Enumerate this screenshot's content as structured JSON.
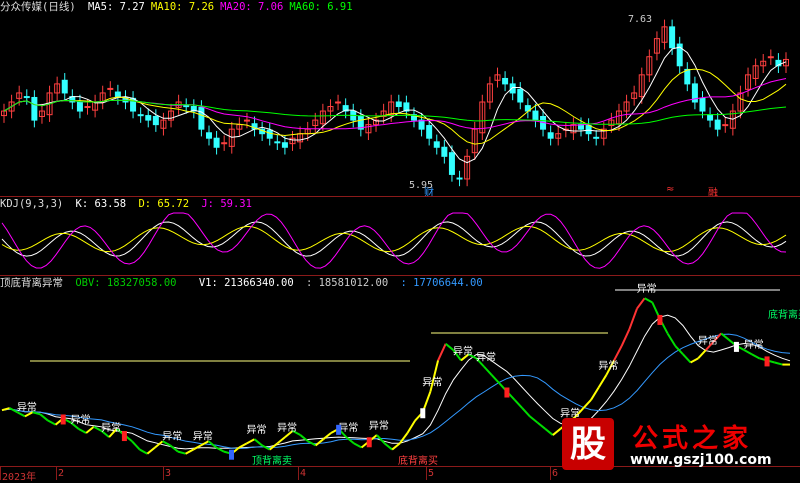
{
  "price_panel": {
    "title": "分众传媒(日线)",
    "ma": [
      {
        "label": "MA5: ",
        "value": "7.27",
        "color": "#ffffff"
      },
      {
        "label": "MA10: ",
        "value": "7.26",
        "color": "#ffff00"
      },
      {
        "label": "MA20: ",
        "value": "7.06",
        "color": "#ff00ff"
      },
      {
        "label": "MA60: ",
        "value": "6.91",
        "color": "#00ff00"
      }
    ],
    "high_label": "7.63",
    "low_label": "5.95",
    "badge_left": "财",
    "badge_right_a": "≈",
    "badge_right_b": "融"
  },
  "kdj_panel": {
    "title": "KDJ(9,3,3)",
    "k": "K: 63.58",
    "d": "D: 65.72",
    "j": "J: 59.31",
    "k_color": "#ffffff",
    "d_color": "#ffff00",
    "j_color": "#ff00ff"
  },
  "obv_panel": {
    "title": "顶底背离异常",
    "obv": "OBV: 18327058.00",
    "v1": "V1: 21366340.00",
    "v2": ": 18581012.00",
    "v3": ": 17706644.00",
    "obv_color": "#00cc00",
    "v1_color": "#ffffff",
    "v2_color": "#cccccc",
    "v3_color": "#3399ff",
    "label_abnormal": "异常",
    "label_top": "顶背离卖",
    "label_bottom": "底背离买",
    "label_top_right": "底背离买"
  },
  "x_axis": {
    "labels": [
      {
        "text": "2023年"
      },
      {
        "text": "2"
      },
      {
        "text": "3"
      },
      {
        "text": "4"
      },
      {
        "text": "5"
      },
      {
        "text": "6"
      }
    ]
  },
  "logo": {
    "glyph": "股",
    "name": "公式之家",
    "url": "www.gszj100.com"
  },
  "chart_data": [
    {
      "type": "candlestick",
      "title": "分众传媒(日线)",
      "series": [
        {
          "name": "MA5",
          "color": "#ffffff"
        },
        {
          "name": "MA10",
          "color": "#ffff00"
        },
        {
          "name": "MA20",
          "color": "#ff00ff"
        },
        {
          "name": "MA60",
          "color": "#00ff00"
        }
      ],
      "close": [
        6.7,
        6.8,
        6.9,
        6.85,
        6.6,
        6.7,
        6.9,
        7.0,
        6.9,
        6.8,
        6.7,
        6.75,
        6.8,
        6.9,
        6.95,
        6.85,
        6.8,
        6.7,
        6.65,
        6.6,
        6.55,
        6.6,
        6.7,
        6.8,
        6.75,
        6.7,
        6.5,
        6.4,
        6.3,
        6.35,
        6.5,
        6.55,
        6.6,
        6.5,
        6.45,
        6.4,
        6.35,
        6.3,
        6.4,
        6.45,
        6.5,
        6.6,
        6.7,
        6.75,
        6.8,
        6.7,
        6.6,
        6.5,
        6.55,
        6.6,
        6.7,
        6.8,
        6.75,
        6.7,
        6.6,
        6.5,
        6.4,
        6.3,
        6.2,
        6.0,
        5.95,
        6.2,
        6.5,
        6.8,
        7.0,
        7.1,
        7.0,
        6.9,
        6.8,
        6.7,
        6.6,
        6.5,
        6.4,
        6.45,
        6.5,
        6.55,
        6.5,
        6.45,
        6.4,
        6.5,
        6.6,
        6.7,
        6.8,
        6.9,
        7.1,
        7.3,
        7.5,
        7.63,
        7.4,
        7.2,
        7.0,
        6.8,
        6.7,
        6.6,
        6.5,
        6.55,
        6.7,
        6.9,
        7.1,
        7.2,
        7.25,
        7.3,
        7.2,
        7.27
      ],
      "high": 7.63,
      "low": 5.95
    },
    {
      "type": "line",
      "title": "KDJ(9,3,3)",
      "series": [
        {
          "name": "K",
          "last": 63.58
        },
        {
          "name": "D",
          "last": 65.72
        },
        {
          "name": "J",
          "last": 59.31
        }
      ]
    },
    {
      "type": "line",
      "title": "顶底背离异常",
      "series": [
        {
          "name": "OBV",
          "last": 18327058.0
        },
        {
          "name": "V1",
          "last": 21366340.0
        },
        {
          "name": "",
          "last": 18581012.0
        },
        {
          "name": "",
          "last": 17706644.0
        }
      ],
      "obv": [
        1.61,
        1.62,
        1.6,
        1.58,
        1.6,
        1.59,
        1.56,
        1.54,
        1.57,
        1.55,
        1.52,
        1.5,
        1.53,
        1.51,
        1.48,
        1.52,
        1.49,
        1.46,
        1.42,
        1.4,
        1.43,
        1.46,
        1.44,
        1.41,
        1.4,
        1.42,
        1.44,
        1.46,
        1.43,
        1.41,
        1.4,
        1.43,
        1.45,
        1.47,
        1.44,
        1.42,
        1.45,
        1.48,
        1.51,
        1.49,
        1.46,
        1.44,
        1.47,
        1.5,
        1.52,
        1.48,
        1.45,
        1.43,
        1.46,
        1.49,
        1.45,
        1.42,
        1.45,
        1.5,
        1.56,
        1.6,
        1.7,
        1.85,
        1.93,
        1.9,
        1.85,
        1.88,
        1.86,
        1.82,
        1.78,
        1.74,
        1.7,
        1.66,
        1.62,
        1.58,
        1.55,
        1.52,
        1.49,
        1.52,
        1.55,
        1.58,
        1.62,
        1.66,
        1.72,
        1.78,
        1.85,
        1.92,
        2.0,
        2.1,
        2.15,
        2.13,
        2.05,
        1.98,
        1.92,
        1.88,
        1.84,
        1.86,
        1.9,
        1.94,
        1.98,
        1.95,
        1.92,
        1.9,
        1.88,
        1.86,
        1.85,
        1.84,
        1.83,
        1.83
      ]
    }
  ]
}
